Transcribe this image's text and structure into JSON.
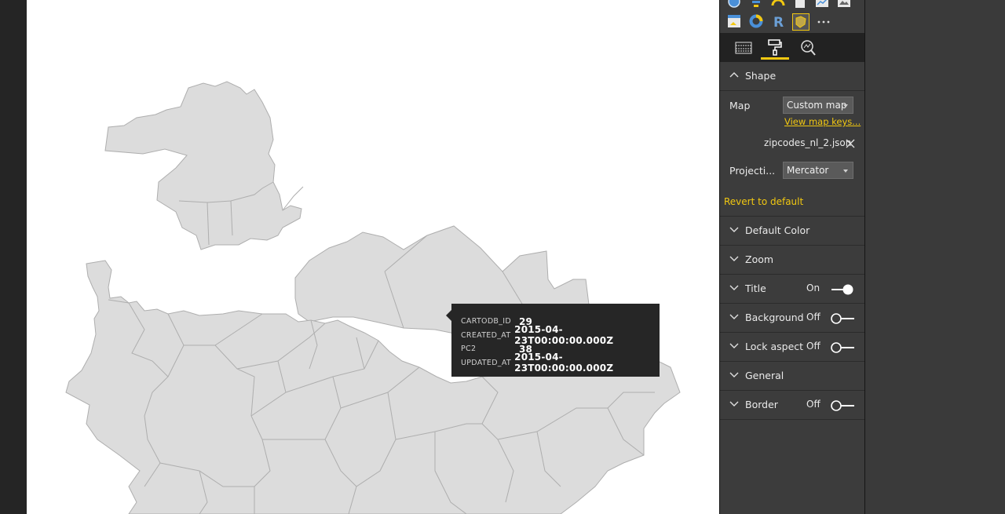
{
  "tooltip": {
    "rows": [
      {
        "key": "CARTODB_ID",
        "value": "29"
      },
      {
        "key": "CREATED_AT",
        "value": "2015-04-23T00:00:00.000Z"
      },
      {
        "key": "PC2",
        "value": "38"
      },
      {
        "key": "UPDATED_AT",
        "value": "2015-04-23T00:00:00.000Z"
      }
    ]
  },
  "panel": {
    "viz_icons": [
      "globe-icon",
      "funnel-icon",
      "gauge-icon",
      "card-icon",
      "kpi-icon",
      "image-icon",
      "table-icon",
      "donut-icon",
      "r-visual-icon",
      "shape-map-icon",
      "more-icon"
    ],
    "tabs": [
      "fields-tab",
      "format-tab",
      "analytics-tab"
    ],
    "shape": {
      "title": "Shape",
      "map_label": "Map",
      "map_value": "Custom map",
      "view_keys_link": "View map keys...",
      "file_name": "zipcodes_nl_2.json",
      "projection_label": "Projecti...",
      "projection_value": "Mercator",
      "revert": "Revert to default"
    },
    "sections": [
      {
        "title": "Default Color",
        "state": ""
      },
      {
        "title": "Zoom",
        "state": ""
      },
      {
        "title": "Title",
        "state": "On"
      },
      {
        "title": "Background",
        "state": "Off"
      },
      {
        "title": "Lock aspect",
        "state": "Off"
      },
      {
        "title": "General",
        "state": ""
      },
      {
        "title": "Border",
        "state": "Off"
      }
    ]
  },
  "colors": {
    "accent": "#f2c811",
    "region_fill": "#dcdcdc",
    "panel_bg": "#3c3c3c",
    "tooltip_bg": "#262626"
  }
}
